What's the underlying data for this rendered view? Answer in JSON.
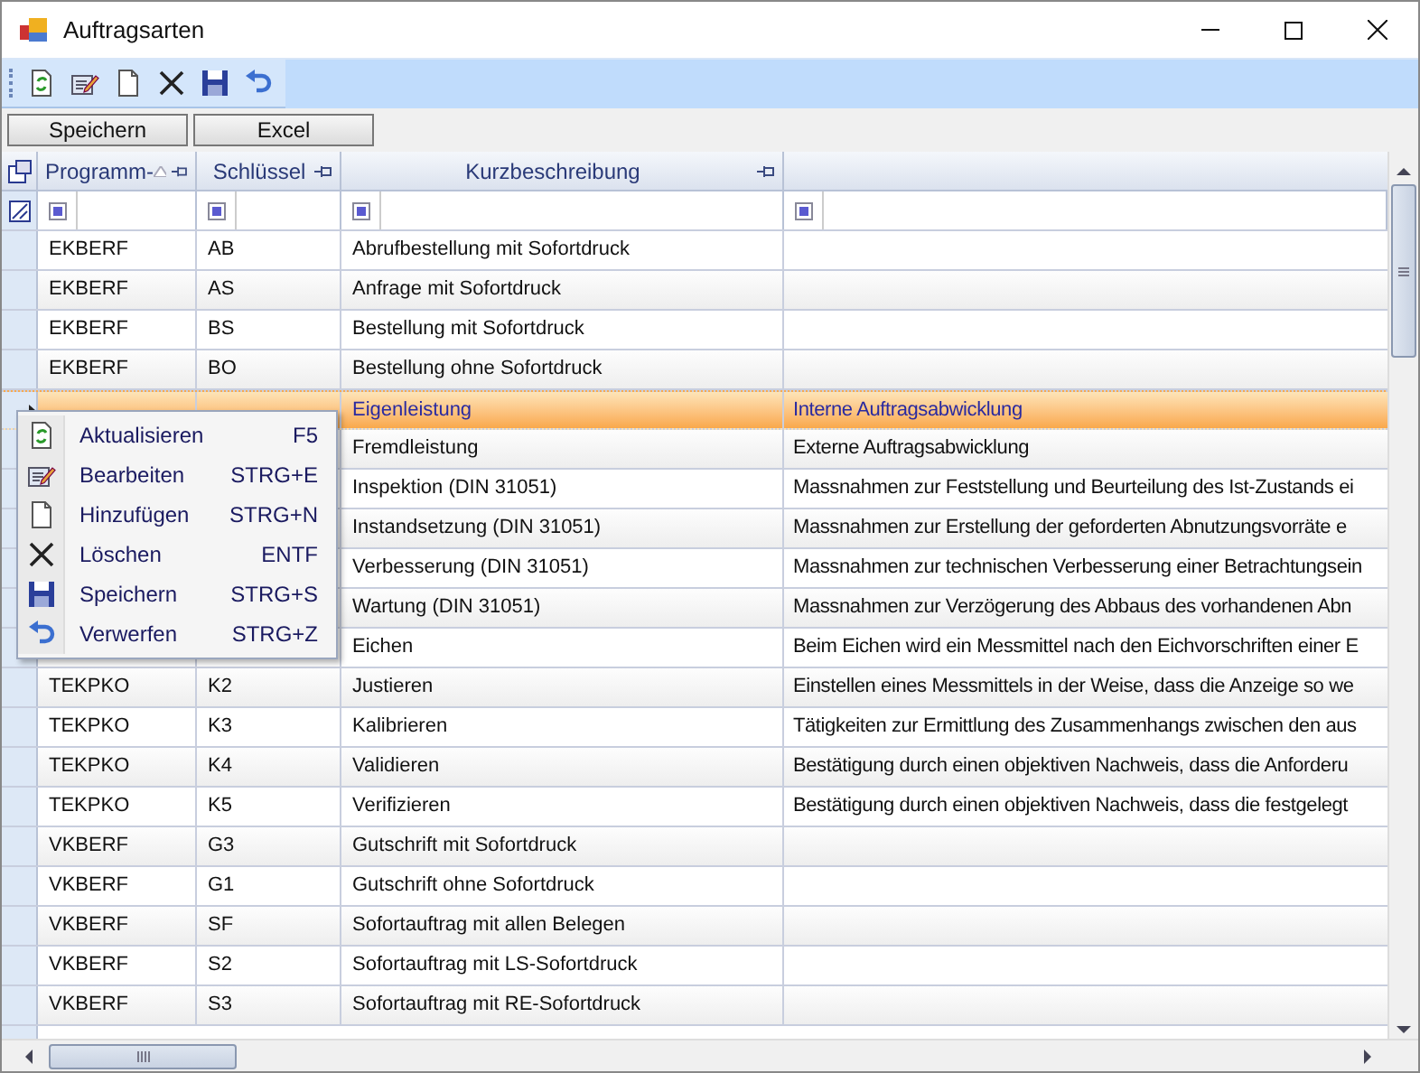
{
  "window": {
    "title": "Auftragsarten"
  },
  "buttons": [
    "Speichern",
    "Excel"
  ],
  "table": {
    "columns": [
      {
        "label": "Programm-",
        "sorted": true
      },
      {
        "label": "Schlüssel",
        "sorted": false
      },
      {
        "label": "Kurzbeschreibung",
        "sorted": false
      }
    ],
    "rows": [
      {
        "program": "EKBERF",
        "key": "AB",
        "description": "Abrufbestellung mit Sofortdruck",
        "selected": false
      },
      {
        "program": "EKBERF",
        "key": "AS",
        "description": "Anfrage mit Sofortdruck",
        "selected": false
      },
      {
        "program": "EKBERF",
        "key": "BS",
        "description": "Bestellung mit Sofortdruck",
        "selected": false
      },
      {
        "program": "EKBERF",
        "key": "BO",
        "description": "Bestellung ohne Sofortdruck",
        "selected": false
      },
      {
        "description": "Eigenleistung",
        "column_4": "Interne Auftragsabwicklung",
        "selected": true
      },
      {
        "description": "Fremdleistung",
        "column_4": "Externe Auftragsabwicklung",
        "selected": false
      },
      {
        "description": "Inspektion (DIN 31051)",
        "column_4": "Massnahmen zur Feststellung und Beurteilung des Ist-Zustands ei",
        "selected": false
      },
      {
        "description": "Instandsetzung (DIN 31051)",
        "column_4": "Massnahmen zur Erstellung der geforderten Abnutzungsvorräte e",
        "selected": false
      },
      {
        "description": "Verbesserung (DIN 31051)",
        "column_4": "Massnahmen zur technischen Verbesserung einer Betrachtungsein",
        "selected": false
      },
      {
        "description": "Wartung (DIN 31051)",
        "column_4": "Massnahmen zur Verzögerung des Abbaus des vorhandenen Abn",
        "selected": false
      },
      {
        "description": "Eichen",
        "column_4": "Beim Eichen wird ein Messmittel nach den Eichvorschriften einer E",
        "selected": false
      },
      {
        "program": "TEKPKO",
        "key": "K2",
        "description": "Justieren",
        "column_4": "Einstellen eines Messmittels in der Weise, dass die Anzeige so we",
        "selected": false
      },
      {
        "program": "TEKPKO",
        "key": "K3",
        "description": "Kalibrieren",
        "column_4": "Tätigkeiten zur Ermittlung des Zusammenhangs zwischen den aus",
        "selected": false
      },
      {
        "program": "TEKPKO",
        "key": "K4",
        "description": "Validieren",
        "column_4": "Bestätigung durch einen objektiven Nachweis, dass die Anforderu",
        "selected": false
      },
      {
        "program": "TEKPKO",
        "key": "K5",
        "description": "Verifizieren",
        "column_4": "Bestätigung durch einen objektiven Nachweis, dass die festgelegt",
        "selected": false
      },
      {
        "program": "VKBERF",
        "key": "G3",
        "description": "Gutschrift mit Sofortdruck",
        "selected": false
      },
      {
        "program": "VKBERF",
        "key": "G1",
        "description": "Gutschrift ohne Sofortdruck",
        "selected": false
      },
      {
        "program": "VKBERF",
        "key": "SF",
        "description": "Sofortauftrag mit allen Belegen",
        "selected": false
      },
      {
        "program": "VKBERF",
        "key": "S2",
        "description": "Sofortauftrag mit LS-Sofortdruck",
        "selected": false
      },
      {
        "program": "VKBERF",
        "key": "S3",
        "description": "Sofortauftrag mit RE-Sofortdruck",
        "selected": false
      }
    ]
  },
  "context_menu": {
    "items": [
      {
        "label": "Aktualisieren",
        "shortcut": "F5",
        "kind": "refresh"
      },
      {
        "label": "Bearbeiten",
        "shortcut": "STRG+E",
        "kind": "edit"
      },
      {
        "label": "Hinzufügen",
        "shortcut": "STRG+N",
        "kind": "new"
      },
      {
        "label": "Löschen",
        "shortcut": "ENTF",
        "kind": "delete"
      },
      {
        "label": "Speichern",
        "shortcut": "STRG+S",
        "kind": "save"
      },
      {
        "label": "Verwerfen",
        "shortcut": "STRG+Z",
        "kind": "undo"
      }
    ]
  }
}
